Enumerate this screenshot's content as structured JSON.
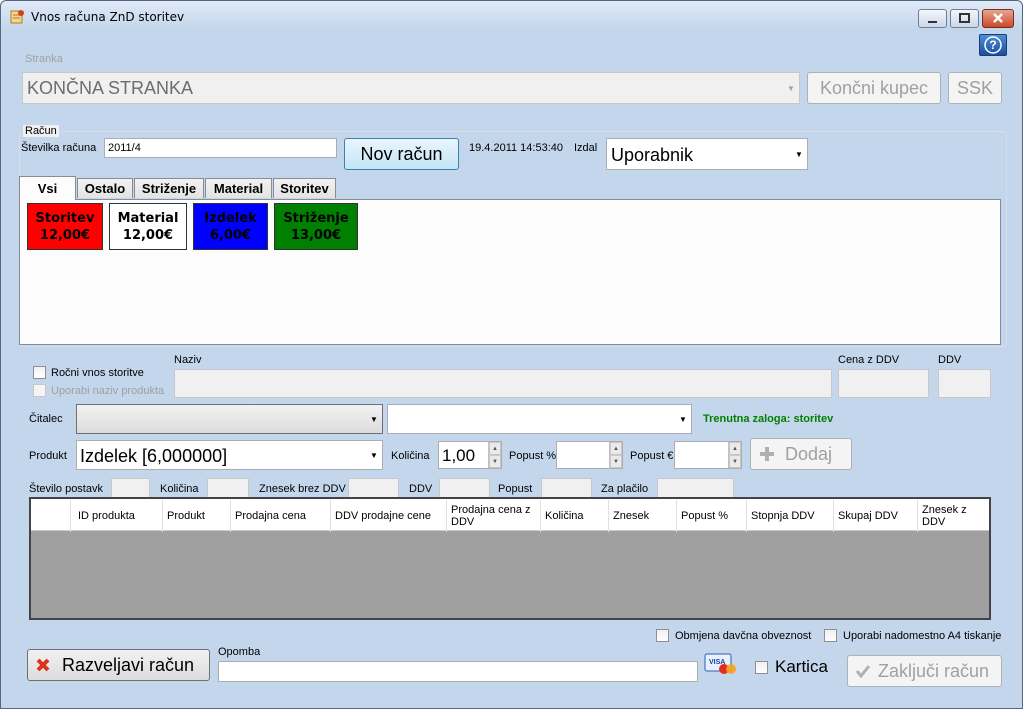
{
  "window": {
    "title": "Vnos računa ZnD storitev"
  },
  "stranka": {
    "label": "Stranka",
    "value": "KONČNA STRANKA",
    "koncni_kupec_label": "Končni kupec",
    "ssk_label": "SSK"
  },
  "racun": {
    "group_label": "Račun",
    "stevilka_label": "Številka računa",
    "stevilka_value": "2011/4",
    "nov_racun_label": "Nov račun",
    "datetime": "19.4.2011 14:53:40",
    "izdal_label": "Izdal",
    "izdal_value": "Uporabnik"
  },
  "tabs": [
    "Vsi",
    "Ostalo",
    "Striženje",
    "Material",
    "Storitev"
  ],
  "tiles": [
    {
      "name": "Storitev",
      "price": "12,00€",
      "color": "#ff0000"
    },
    {
      "name": "Material",
      "price": "12,00€",
      "color": "#ffffff"
    },
    {
      "name": "Izdelek",
      "price": "6,00€",
      "color": "#0000ff"
    },
    {
      "name": "Striženje",
      "price": "13,00€",
      "color": "#008000"
    }
  ],
  "entry": {
    "rocni_vnos_label": "Ročni vnos storitve",
    "uporabi_naziv_label": "Uporabi naziv produkta",
    "naziv_label": "Naziv",
    "cena_label": "Cena z DDV",
    "ddv_label": "DDV",
    "citalec_label": "Čitalec",
    "zaloga_text": "Trenutna zaloga: storitev",
    "produkt_label": "Produkt",
    "produkt_value": "Izdelek [6,000000]",
    "kolicina_label": "Količina",
    "kolicina_value": "1,00",
    "popust_pct_label": "Popust %",
    "popust_eur_label": "Popust €",
    "dodaj_label": "Dodaj"
  },
  "summary": {
    "stevilo_postavk": "Število postavk",
    "kolicina": "Količina",
    "znesek_brez_ddv": "Znesek brez DDV",
    "ddv": "DDV",
    "popust": "Popust",
    "za_placilo": "Za plačilo"
  },
  "table": {
    "columns": [
      "ID produkta",
      "Produkt",
      "Prodajna cena",
      "DDV prodajne cene",
      "Prodajna cena z DDV",
      "Količina",
      "Znesek",
      "Popust %",
      "Stopnja DDV",
      "Skupaj DDV",
      "Znesek z DDV"
    ]
  },
  "footer": {
    "obmjena_label": "Obmjena davčna obveznost",
    "a4_label": "Uporabi nadomestno A4 tiskanje",
    "razveljavi_label": "Razveljavi račun",
    "opomba_label": "Opomba",
    "kartica_label": "Kartica",
    "zakljuci_label": "Zaključi račun"
  },
  "colors": {
    "zaloga": "#008000",
    "grid_bg": "#a0a0a0"
  }
}
